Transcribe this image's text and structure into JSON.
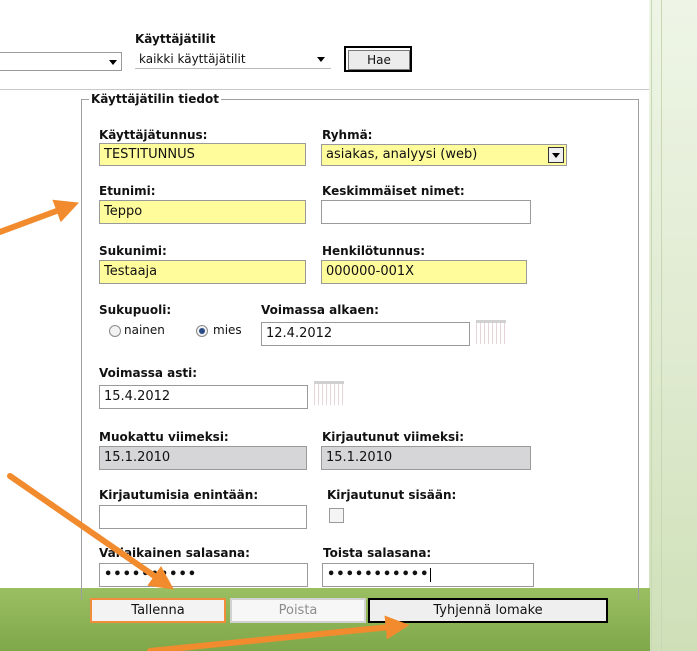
{
  "filters": {
    "accounts_label": "Käyttäjätilit",
    "left_select_value": "",
    "accounts_select_value": "kaikki käyttäjätilit",
    "search_button": "Hae"
  },
  "form": {
    "legend": "Käyttäjätilin tiedot",
    "username": {
      "label": "Käyttäjätunnus:",
      "value": "TESTITUNNUS"
    },
    "group": {
      "label": "Ryhmä:",
      "value": "asiakas, analyysi (web)"
    },
    "first_name": {
      "label": "Etunimi:",
      "value": "Teppo"
    },
    "middle_names": {
      "label": "Keskimmäiset nimet:",
      "value": ""
    },
    "last_name": {
      "label": "Sukunimi:",
      "value": "Testaaja"
    },
    "personal_id": {
      "label": "Henkilötunnus:",
      "value": "000000-001X"
    },
    "gender": {
      "label": "Sukupuoli:",
      "option_female": "nainen",
      "option_male": "mies",
      "selected": "mies"
    },
    "valid_from": {
      "label": "Voimassa alkaen:",
      "value": "12.4.2012"
    },
    "valid_until": {
      "label": "Voimassa asti:",
      "value": "15.4.2012"
    },
    "modified": {
      "label": "Muokattu viimeksi:",
      "value": "15.1.2010"
    },
    "last_login": {
      "label": "Kirjautunut viimeksi:",
      "value": "15.1.2010"
    },
    "max_logins": {
      "label": "Kirjautumisia enintään:",
      "value": ""
    },
    "logged_in": {
      "label": "Kirjautunut sisään:",
      "checked": false
    },
    "temp_password": {
      "label": "Väliaikainen salasana:",
      "value": "••••••••••"
    },
    "repeat_password": {
      "label": "Toista salasana:",
      "value": "•••••••••••"
    }
  },
  "buttons": {
    "save": "Tallenna",
    "delete": "Poista",
    "clear": "Tyhjennä lomake"
  },
  "colors": {
    "required_field": "#fffc9c",
    "readonly_field": "#d6d6d8",
    "annotation_arrow": "#f28b2e",
    "footer_green": "#8ab356"
  }
}
